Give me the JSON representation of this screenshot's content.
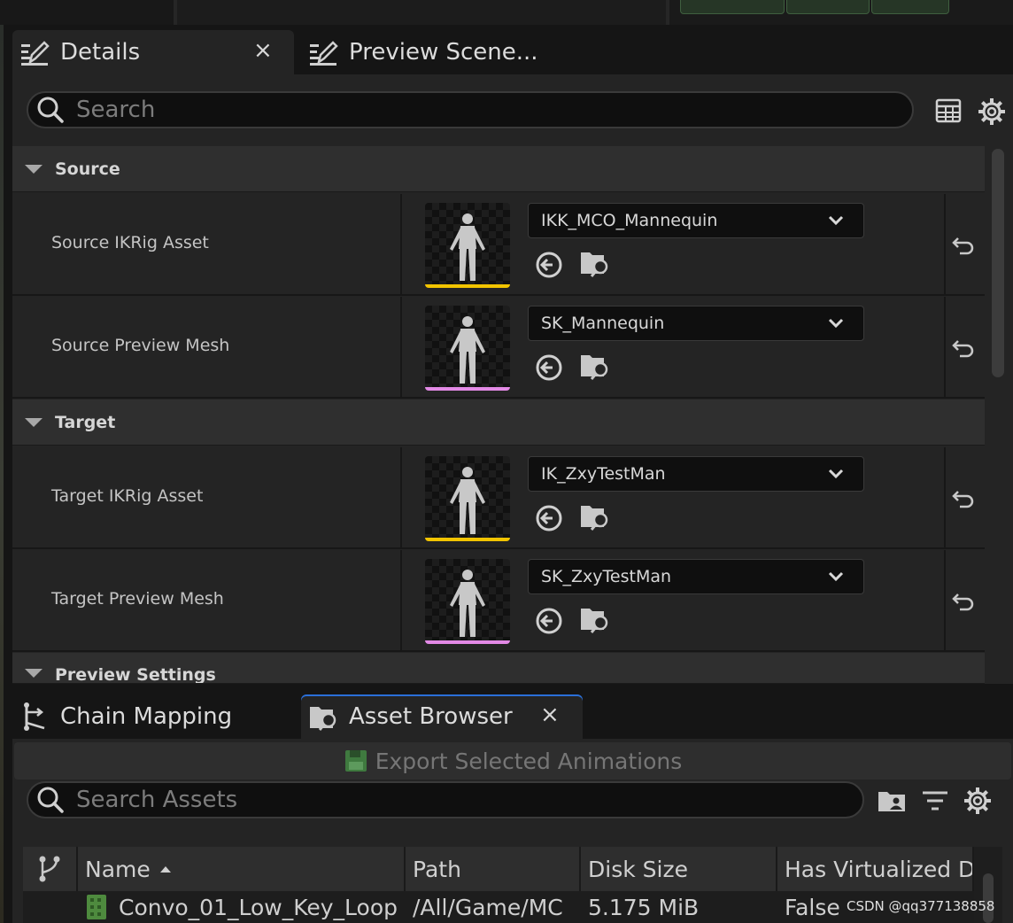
{
  "details_tabs": [
    {
      "label": "Details",
      "close": "×"
    },
    {
      "label": "Preview Scene..."
    }
  ],
  "details_search": {
    "placeholder": "Search"
  },
  "categories": {
    "source": "Source",
    "target": "Target",
    "preview": "Preview Settings"
  },
  "properties": [
    {
      "label": "Source IKRig Asset",
      "value": "IKK_MCO_Mannequin",
      "bar_color": "#f2c400"
    },
    {
      "label": "Source Preview Mesh",
      "value": "SK_Mannequin",
      "bar_color": "#e38ae6"
    },
    {
      "label": "Target IKRig Asset",
      "value": "IK_ZxyTestMan",
      "bar_color": "#f2c400"
    },
    {
      "label": "Target Preview Mesh",
      "value": "SK_ZxyTestMan",
      "bar_color": "#e38ae6"
    }
  ],
  "bottom_tabs": [
    {
      "label": "Chain Mapping"
    },
    {
      "label": "Asset Browser",
      "close": "×"
    }
  ],
  "export_button": "Export Selected Animations",
  "asset_search": {
    "placeholder": "Search Assets"
  },
  "table": {
    "columns": [
      "Name",
      "Path",
      "Disk Size",
      "Has Virtualized Da"
    ],
    "rows": [
      {
        "name": "Convo_01_Low_Key_Loop",
        "path": "/All/Game/MC",
        "disk_size": "5.175 MiB",
        "virtualized": "False"
      }
    ]
  },
  "watermark": "CSDN @qq377138858",
  "colors": {
    "accent": "#2a6fd8",
    "ikrig_bar": "#f2c400",
    "mesh_bar": "#e38ae6",
    "export_icon": "#3f7a3f"
  }
}
